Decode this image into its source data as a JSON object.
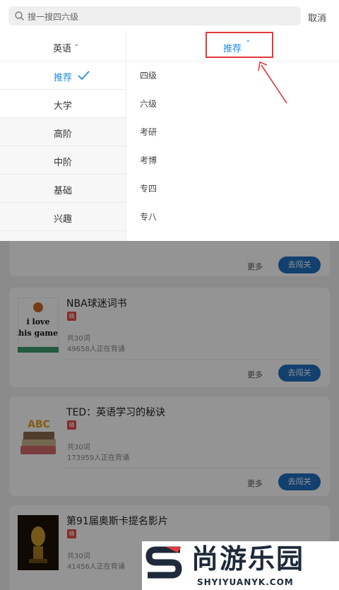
{
  "search": {
    "placeholder": "搜一搜四六级",
    "cancel_label": "取消"
  },
  "filter": {
    "left_header": "英语",
    "left_items": [
      {
        "label": "推荐",
        "selected": true
      },
      {
        "label": "大学",
        "selected": false
      },
      {
        "label": "高阶",
        "selected": false
      },
      {
        "label": "中阶",
        "selected": false
      },
      {
        "label": "基础",
        "selected": false
      },
      {
        "label": "兴趣",
        "selected": false
      }
    ],
    "right_header": "推荐",
    "right_items": [
      "四级",
      "六级",
      "考研",
      "考博",
      "专四",
      "专八"
    ]
  },
  "cards": [
    {
      "title": "",
      "tag": "",
      "words": "",
      "learners": "",
      "more_label": "更多",
      "button_label": "去闯关"
    },
    {
      "title": "NBA球迷词书",
      "tag": "精",
      "words": "共30词",
      "learners": "49658人正在背诵",
      "more_label": "更多",
      "button_label": "去闯关"
    },
    {
      "title": "TED：英语学习的秘诀",
      "tag": "精",
      "words": "共30词",
      "learners": "173959人正在背诵",
      "more_label": "更多",
      "button_label": "去闯关"
    },
    {
      "title": "第91届奥斯卡提名影片",
      "tag": "精",
      "words": "共30词",
      "learners": "41456人正在背诵",
      "more_label": "",
      "button_label": ""
    }
  ],
  "thumbnails": {
    "nba": "i love this game!",
    "ted": "ABC"
  },
  "watermark": {
    "title": "尚游乐园",
    "url": "SHYIYUANYK.COM"
  },
  "colors": {
    "accent": "#1f8fe0",
    "button": "#1f6fbf",
    "highlight": "#e03a3a",
    "tag": "#e24a4a"
  }
}
